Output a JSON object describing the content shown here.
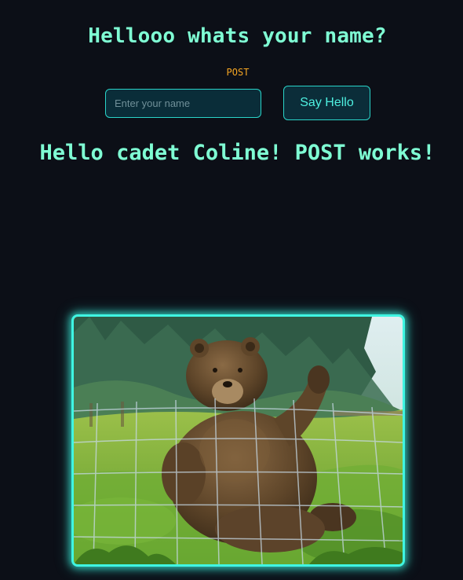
{
  "header": {
    "title": "Hellooo whats your name?",
    "method_label": "POST"
  },
  "form": {
    "name_placeholder": "Enter your name",
    "name_value": "",
    "submit_label": "Say Hello"
  },
  "result": {
    "greeting": "Hello cadet Coline! POST works!"
  },
  "media": {
    "image_subject": "waving-bear"
  },
  "colors": {
    "background": "#0c0f17",
    "heading": "#7fffd4",
    "method_label": "#f5a623",
    "accent": "#2ad4c9",
    "button_text": "#4ef0e0"
  }
}
